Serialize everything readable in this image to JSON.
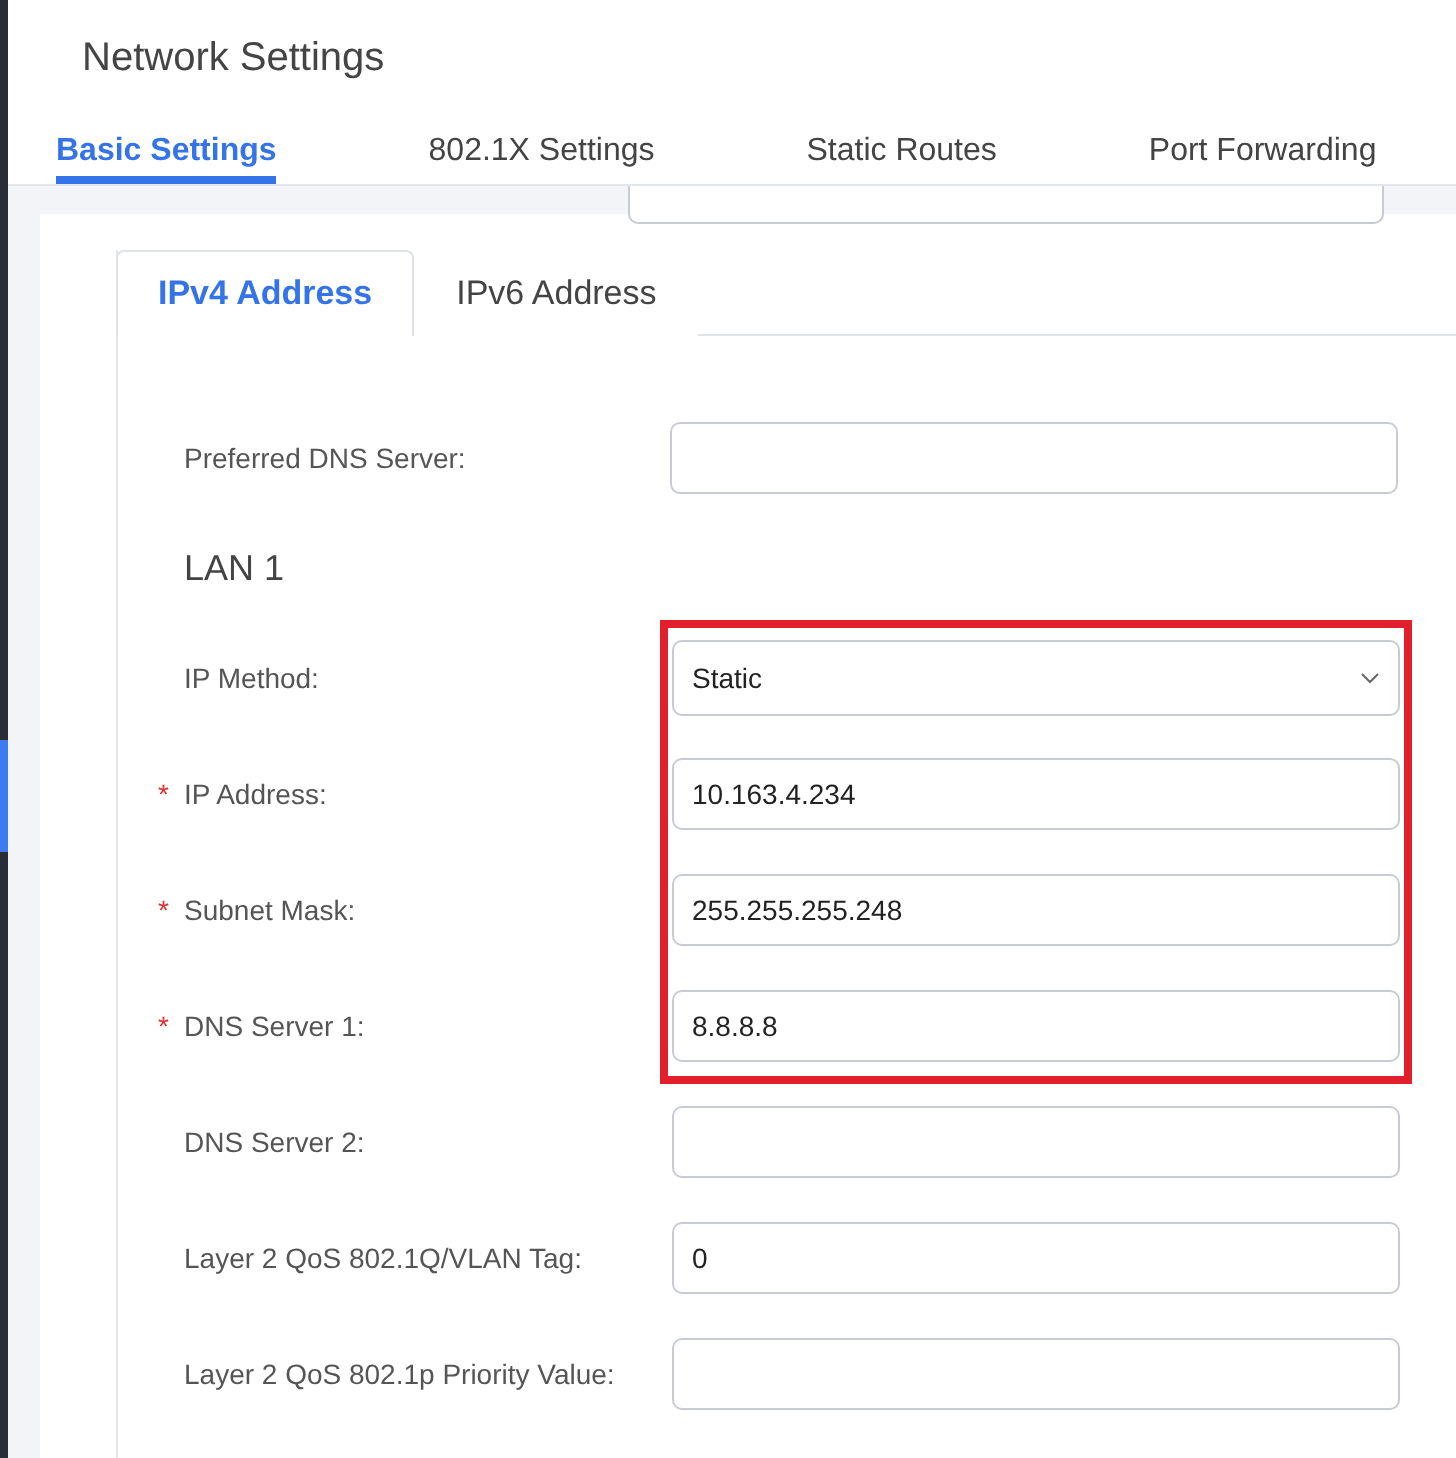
{
  "page_title": "Network Settings",
  "tabs": [
    {
      "label": "Basic Settings",
      "selected": true
    },
    {
      "label": "802.1X Settings",
      "selected": false
    },
    {
      "label": "Static Routes",
      "selected": false
    },
    {
      "label": "Port Forwarding",
      "selected": false
    }
  ],
  "subtabs": [
    {
      "label": "IPv4 Address",
      "selected": true
    },
    {
      "label": "IPv6 Address",
      "selected": false
    }
  ],
  "top_field": {
    "label": "Preferred DNS Server:"
  },
  "section_title": "LAN 1",
  "fields": [
    {
      "label": "IP Method:",
      "kind": "select",
      "value": "Static",
      "highlighted": true
    },
    {
      "label": "IP Address:",
      "kind": "text",
      "value": "10.163.4.234",
      "required_mark": "*",
      "highlighted": true
    },
    {
      "label": "Subnet Mask:",
      "kind": "text",
      "value": "255.255.255.248",
      "required_mark": "*",
      "highlighted": true
    },
    {
      "label": "DNS Server 1:",
      "kind": "text",
      "value": "8.8.8.8",
      "required_mark": "*",
      "highlighted": true
    },
    {
      "label": "DNS Server 2:",
      "kind": "text",
      "highlighted": false
    },
    {
      "label": "Layer 2 QoS 802.1Q/VLAN Tag:",
      "kind": "text",
      "value": "0",
      "highlighted": false
    },
    {
      "label": "Layer 2 QoS 802.1p Priority Value:",
      "kind": "text",
      "highlighted": false
    }
  ]
}
